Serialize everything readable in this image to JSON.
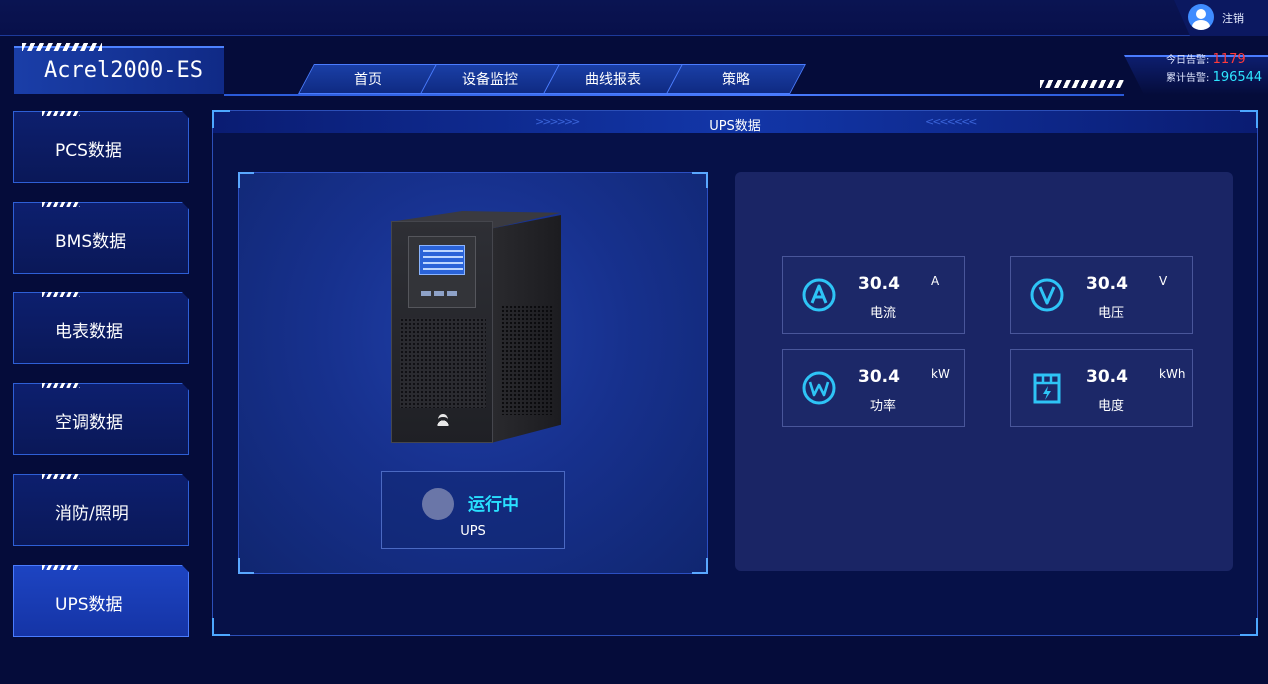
{
  "header": {
    "brand": "Acrel2000-ES",
    "logout_label": "注销",
    "nav_tabs": [
      {
        "label": "首页"
      },
      {
        "label": "设备监控"
      },
      {
        "label": "曲线报表"
      },
      {
        "label": "策略"
      }
    ],
    "alarms": {
      "today_label": "今日告警:",
      "today_value": "1179",
      "total_label": "累计告警:",
      "total_value": "196544"
    }
  },
  "sidebar": {
    "items": [
      {
        "label": "PCS数据",
        "active": false
      },
      {
        "label": "BMS数据",
        "active": false
      },
      {
        "label": "电表数据",
        "active": false
      },
      {
        "label": "空调数据",
        "active": false
      },
      {
        "label": "消防/照明",
        "active": false
      },
      {
        "label": "UPS数据",
        "active": true
      }
    ]
  },
  "panel": {
    "title": "UPS数据",
    "left_chevrons": ">>>>>>",
    "right_chevrons": "<<<<<<<"
  },
  "device": {
    "status": "运行中",
    "name": "UPS"
  },
  "metrics": [
    {
      "icon": "ampere-icon",
      "value": "30.4",
      "unit": "A",
      "label": "电流"
    },
    {
      "icon": "volt-icon",
      "value": "30.4",
      "unit": "V",
      "label": "电压"
    },
    {
      "icon": "watt-icon",
      "value": "30.4",
      "unit": "kW",
      "label": "功率"
    },
    {
      "icon": "energy-meter-icon",
      "value": "30.4",
      "unit": "kWh",
      "label": "电度"
    }
  ],
  "colors": {
    "accent": "#2ec4f6",
    "status_running": "#29e0ff",
    "alarm_today": "#ff3a3a",
    "alarm_total": "#2ee6ff",
    "background": "#050c3a"
  }
}
